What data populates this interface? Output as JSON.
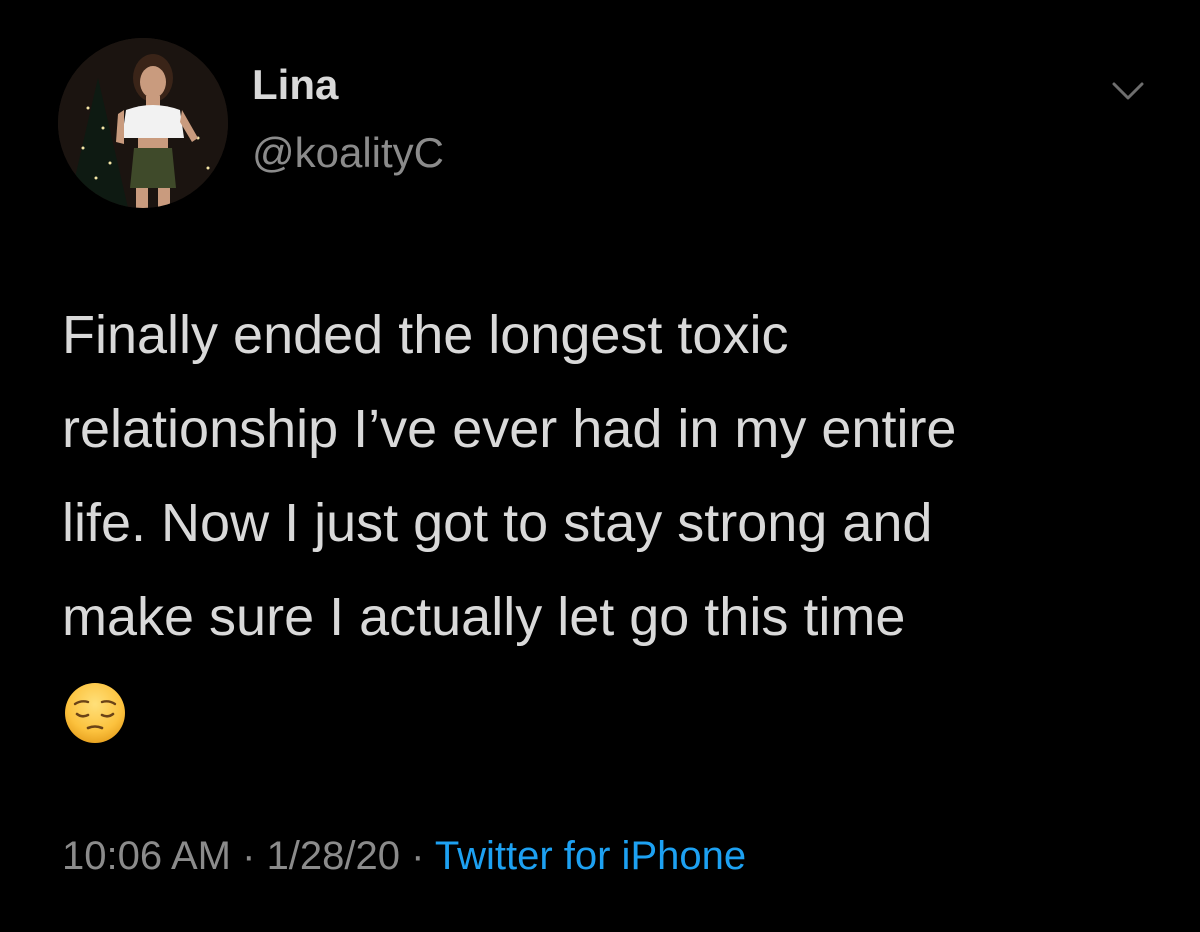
{
  "author": {
    "display_name": "Lina",
    "handle": "@koalityC",
    "avatar_icon": "profile-photo"
  },
  "tweet": {
    "text_lines": [
      "Finally ended the longest toxic",
      "relationship I’ve ever had in my entire",
      "life. Now I just got to stay strong and",
      "make sure I actually let go this time"
    ],
    "emoji": "😔",
    "time": "10:06 AM",
    "separator": " · ",
    "date": "1/28/20",
    "source": "Twitter for iPhone"
  },
  "colors": {
    "background": "#000000",
    "primary_text": "#d9d9d9",
    "secondary_text": "#8b8b8b",
    "link": "#1da1f2"
  },
  "icons": {
    "menu": "chevron-down-icon"
  }
}
